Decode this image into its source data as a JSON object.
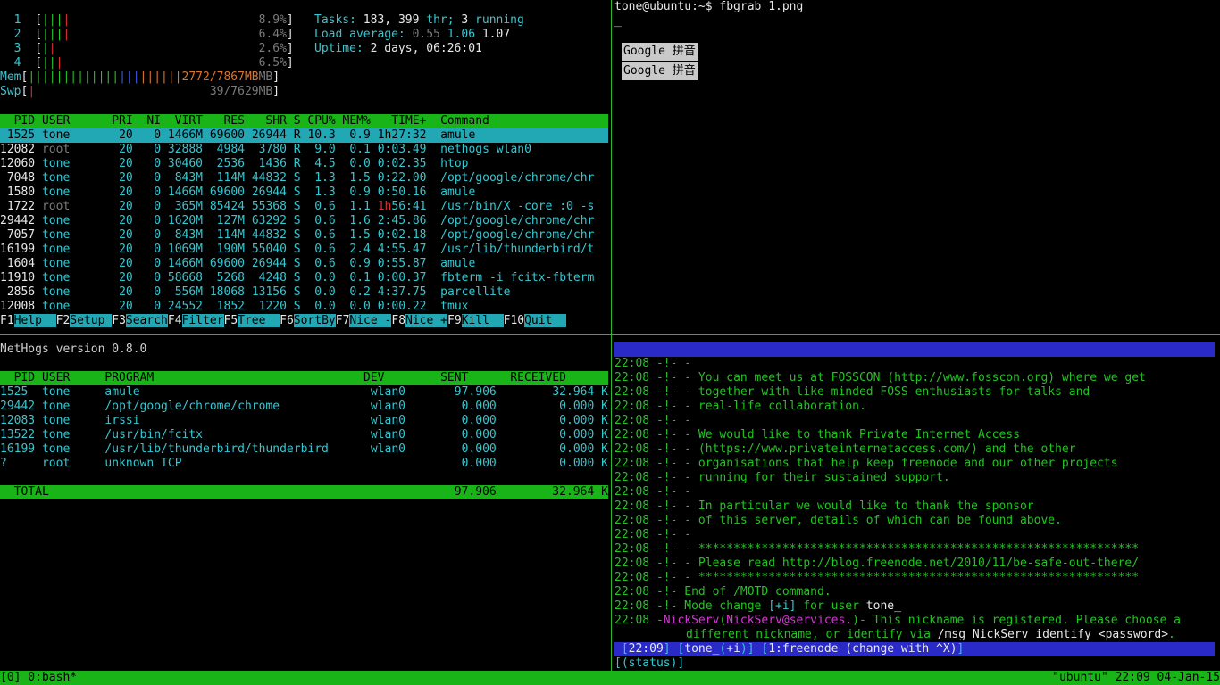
{
  "htop": {
    "cpus": [
      {
        "num": "1",
        "bar": "||||",
        "pct": "8.9%"
      },
      {
        "num": "2",
        "bar": "||||",
        "pct": "6.4%"
      },
      {
        "num": "3",
        "bar": "||",
        "pct": "2.6%"
      },
      {
        "num": "4",
        "bar": "|||",
        "pct": "6.5%"
      }
    ],
    "mem_label": "Mem",
    "mem_bar": "||||||||||||||||||||||",
    "mem_value": "2772/7867MB",
    "swp_label": "Swp",
    "swp_bar": "|",
    "swp_value": "39/7629MB",
    "tasks_label": "Tasks:",
    "tasks_value": "183,",
    "thr_value": "399",
    "thr_label": "thr;",
    "running_value": "3",
    "running_label": "running",
    "load_label": "Load average:",
    "load1": "0.55",
    "load5": "1.06",
    "load15": "1.07",
    "uptime_label": "Uptime:",
    "uptime_value": "2 days, 06:26:01",
    "columns": "  PID USER      PRI  NI  VIRT   RES   SHR S CPU% MEM%   TIME+  Command",
    "rows": [
      {
        "pid": " 1525",
        "user": "tone",
        "pri": "20",
        "ni": "0",
        "virt": "1466M",
        "res": "69600",
        "shr": "26944",
        "s": "R",
        "cpu": "10.3",
        "mem": "0.9",
        "time_h": "1h",
        "time": "27:32",
        "cmd": "amule"
      },
      {
        "pid": "12082",
        "user": "root",
        "pri": "20",
        "ni": "0",
        "virt": "32888",
        "res": "4984",
        "shr": "3780",
        "s": "R",
        "cpu": "9.0",
        "mem": "0.1",
        "time_h": "",
        "time": "0:03.49",
        "cmd": "nethogs wlan0"
      },
      {
        "pid": "12060",
        "user": "tone",
        "pri": "20",
        "ni": "0",
        "virt": "30460",
        "res": "2536",
        "shr": "1436",
        "s": "R",
        "cpu": "4.5",
        "mem": "0.0",
        "time_h": "",
        "time": "0:02.35",
        "cmd": "htop"
      },
      {
        "pid": " 7048",
        "user": "tone",
        "pri": "20",
        "ni": "0",
        "virt": "843M",
        "res": "114M",
        "shr": "44832",
        "s": "S",
        "cpu": "1.3",
        "mem": "1.5",
        "time_h": "",
        "time": "0:22.00",
        "cmd": "/opt/google/chrome/chr"
      },
      {
        "pid": " 1580",
        "user": "tone",
        "pri": "20",
        "ni": "0",
        "virt": "1466M",
        "res": "69600",
        "shr": "26944",
        "s": "S",
        "cpu": "1.3",
        "mem": "0.9",
        "time_h": "",
        "time": "0:50.16",
        "cmd": "amule"
      },
      {
        "pid": " 1722",
        "user": "root",
        "pri": "20",
        "ni": "0",
        "virt": "365M",
        "res": "85424",
        "shr": "55368",
        "s": "S",
        "cpu": "0.6",
        "mem": "1.1",
        "time_h": "1h",
        "time": "56:41",
        "cmd": "/usr/bin/X -core :0 -s"
      },
      {
        "pid": "29442",
        "user": "tone",
        "pri": "20",
        "ni": "0",
        "virt": "1620M",
        "res": "127M",
        "shr": "63292",
        "s": "S",
        "cpu": "0.6",
        "mem": "1.6",
        "time_h": "",
        "time": "2:45.86",
        "cmd": "/opt/google/chrome/chr"
      },
      {
        "pid": " 7057",
        "user": "tone",
        "pri": "20",
        "ni": "0",
        "virt": "843M",
        "res": "114M",
        "shr": "44832",
        "s": "S",
        "cpu": "0.6",
        "mem": "1.5",
        "time_h": "",
        "time": "0:02.18",
        "cmd": "/opt/google/chrome/chr"
      },
      {
        "pid": "16199",
        "user": "tone",
        "pri": "20",
        "ni": "0",
        "virt": "1069M",
        "res": "190M",
        "shr": "55040",
        "s": "S",
        "cpu": "0.6",
        "mem": "2.4",
        "time_h": "",
        "time": "4:55.47",
        "cmd": "/usr/lib/thunderbird/t"
      },
      {
        "pid": " 1604",
        "user": "tone",
        "pri": "20",
        "ni": "0",
        "virt": "1466M",
        "res": "69600",
        "shr": "26944",
        "s": "S",
        "cpu": "0.6",
        "mem": "0.9",
        "time_h": "",
        "time": "0:55.87",
        "cmd": "amule"
      },
      {
        "pid": "11910",
        "user": "tone",
        "pri": "20",
        "ni": "0",
        "virt": "58668",
        "res": "5268",
        "shr": "4248",
        "s": "S",
        "cpu": "0.0",
        "mem": "0.1",
        "time_h": "",
        "time": "0:00.37",
        "cmd": "fbterm -i fcitx-fbterm"
      },
      {
        "pid": " 2856",
        "user": "tone",
        "pri": "20",
        "ni": "0",
        "virt": "556M",
        "res": "18068",
        "shr": "13156",
        "s": "S",
        "cpu": "0.0",
        "mem": "0.2",
        "time_h": "",
        "time": "4:37.75",
        "cmd": "parcellite"
      },
      {
        "pid": "12008",
        "user": "tone",
        "pri": "20",
        "ni": "0",
        "virt": "24552",
        "res": "1852",
        "shr": "1220",
        "s": "S",
        "cpu": "0.0",
        "mem": "0.0",
        "time_h": "",
        "time": "0:00.22",
        "cmd": "tmux"
      }
    ],
    "fkeys": [
      {
        "k": "F1",
        "l": "Help  "
      },
      {
        "k": "F2",
        "l": "Setup "
      },
      {
        "k": "F3",
        "l": "Search"
      },
      {
        "k": "F4",
        "l": "Filter"
      },
      {
        "k": "F5",
        "l": "Tree  "
      },
      {
        "k": "F6",
        "l": "SortBy"
      },
      {
        "k": "F7",
        "l": "Nice -"
      },
      {
        "k": "F8",
        "l": "Nice +"
      },
      {
        "k": "F9",
        "l": "Kill  "
      },
      {
        "k": "F10",
        "l": "Quit  "
      }
    ]
  },
  "shell": {
    "prompt": "tone@ubuntu:~$ ",
    "command": "fbgrab 1.png",
    "cursor": "_",
    "ime_lines": [
      "Google 拼音",
      "Google 拼音"
    ]
  },
  "nethogs": {
    "version": "NetHogs version 0.8.0",
    "columns": "  PID USER     PROGRAM                              DEV        SENT      RECEIVED       ",
    "rows": [
      {
        "pid": "1525",
        "user": "tone",
        "program": "amule",
        "dev": "wlan0",
        "sent": "97.906",
        "recv": "32.964",
        "unit": "KB/sec"
      },
      {
        "pid": "29442",
        "user": "tone",
        "program": "/opt/google/chrome/chrome",
        "dev": "wlan0",
        "sent": "0.000",
        "recv": "0.000",
        "unit": "KB/sec"
      },
      {
        "pid": "12083",
        "user": "tone",
        "program": "irssi",
        "dev": "wlan0",
        "sent": "0.000",
        "recv": "0.000",
        "unit": "KB/sec"
      },
      {
        "pid": "13522",
        "user": "tone",
        "program": "/usr/bin/fcitx",
        "dev": "wlan0",
        "sent": "0.000",
        "recv": "0.000",
        "unit": "KB/sec"
      },
      {
        "pid": "16199",
        "user": "tone",
        "program": "/usr/lib/thunderbird/thunderbird",
        "dev": "wlan0",
        "sent": "0.000",
        "recv": "0.000",
        "unit": "KB/sec"
      },
      {
        "pid": "?",
        "user": "root",
        "program": "unknown TCP",
        "dev": "",
        "sent": "0.000",
        "recv": "0.000",
        "unit": "KB/sec"
      }
    ],
    "total_label": "TOTAL",
    "total_sent": "97.906",
    "total_recv": "32.964",
    "total_unit": "KB/sec"
  },
  "irssi": {
    "lines": [
      {
        "ts": "22:08",
        "pre": "-!- -",
        "text": ""
      },
      {
        "ts": "22:08",
        "pre": "-!- -",
        "text": " You can meet us at FOSSCON (http://www.fosscon.org) where we get"
      },
      {
        "ts": "22:08",
        "pre": "-!- -",
        "text": " together with like-minded FOSS enthusiasts for talks and"
      },
      {
        "ts": "22:08",
        "pre": "-!- -",
        "text": " real-life collaboration."
      },
      {
        "ts": "22:08",
        "pre": "-!- -",
        "text": ""
      },
      {
        "ts": "22:08",
        "pre": "-!- -",
        "text": " We would like to thank Private Internet Access"
      },
      {
        "ts": "22:08",
        "pre": "-!- -",
        "text": " (https://www.privateinternetaccess.com/) and the other"
      },
      {
        "ts": "22:08",
        "pre": "-!- -",
        "text": " organisations that help keep freenode and our other projects"
      },
      {
        "ts": "22:08",
        "pre": "-!- -",
        "text": " running for their sustained support."
      },
      {
        "ts": "22:08",
        "pre": "-!- -",
        "text": ""
      },
      {
        "ts": "22:08",
        "pre": "-!- -",
        "text": " In particular we would like to thank the sponsor"
      },
      {
        "ts": "22:08",
        "pre": "-!- -",
        "text": " of this server, details of which can be found above."
      },
      {
        "ts": "22:08",
        "pre": "-!- -",
        "text": ""
      },
      {
        "ts": "22:08",
        "pre": "-!- -",
        "text": " ***************************************************************"
      },
      {
        "ts": "22:08",
        "pre": "-!- -",
        "text": " Please read http://blog.freenode.net/2010/11/be-safe-out-there/"
      },
      {
        "ts": "22:08",
        "pre": "-!- -",
        "text": " ***************************************************************"
      },
      {
        "ts": "22:08",
        "pre": "-!-",
        "text": " End of /MOTD command."
      }
    ],
    "mode_ts": "22:08",
    "mode_pre": "-!-",
    "mode_text": " Mode change ",
    "mode_flag": "[+i]",
    "mode_for": " for user ",
    "mode_user": "tone_",
    "nick_ts": "22:08",
    "nick_name": "NickServ",
    "nick_host": "NickServ@services.",
    "nick_text": " This nickname is registered. Please choose a",
    "nick_cont_a": "different nickname, or identify via ",
    "nick_cmd": "/msg NickServ identify <password>",
    "status_time": "22:09",
    "status_nick": "tone_",
    "status_mode": "+i",
    "status_win": "1:freenode (change with ^X)",
    "input": "[(status)]"
  },
  "tmux": {
    "left": "[0] 0:bash*",
    "right": "\"ubuntu\" 22:09 04-Jan-15"
  }
}
